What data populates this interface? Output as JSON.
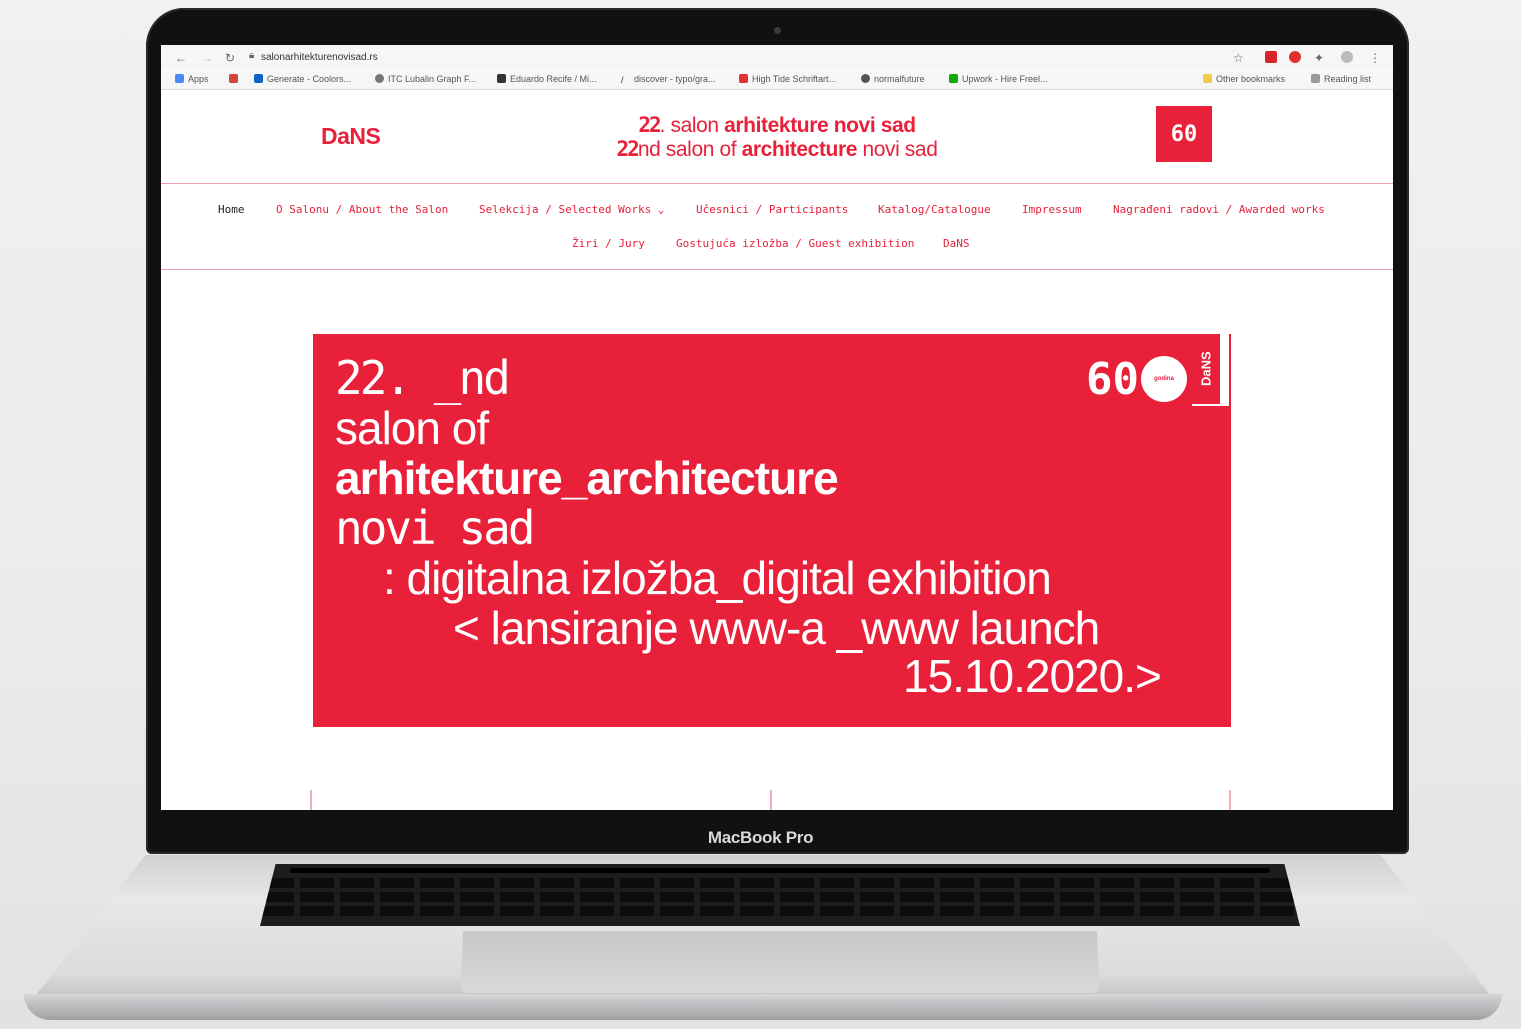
{
  "browser": {
    "url": "salonarhitekturenovisad.rs",
    "bookmarks": [
      "Apps",
      "Generate - Coolors...",
      "ITC Lubalin Graph F...",
      "Eduardo Recife / Mi...",
      "discover - typo/gra...",
      "High Tide Schriftart...",
      "normalfuture",
      "Upwork - Hire Freel...",
      "Other bookmarks",
      "Reading list"
    ]
  },
  "header": {
    "logo": "DaNS",
    "line1_num": "22",
    "line1_rest": ". salon ",
    "line1_bold": "arhitekture novi sad",
    "line2_num": "22",
    "line2_rest": "nd salon of ",
    "line2_bold": "architecture",
    "line2_tail": " novi sad",
    "badge": "60"
  },
  "menu": {
    "row1": [
      "Home",
      "O Salonu / About the Salon",
      "Selekcija / Selected Works ⌄",
      "Učesnici / Participants",
      "Katalog/Catalogue",
      "Impressum",
      "Nagrađeni radovi / Awarded works"
    ],
    "row2": [
      "Žiri / Jury",
      "Gostujuća izložba / Guest exhibition",
      "DaNS"
    ]
  },
  "hero": {
    "line1": "22. _nd",
    "line2": "salon   of",
    "line3": "arhitekture_architecture",
    "line4": "novi sad",
    "line5": ": digitalna izložba_digital exhibition",
    "line6": "< lansiranje www-a   _www launch",
    "line7": "15.10.2020.>",
    "logo_num": "60",
    "tab_label": "DaNS",
    "circle_label": "godina"
  },
  "laptop": {
    "label": "MacBook Pro"
  },
  "colors": {
    "brand_red": "#e8203a"
  }
}
